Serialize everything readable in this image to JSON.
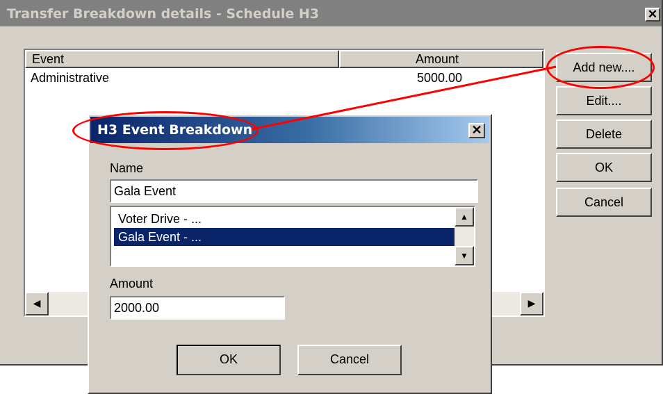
{
  "outer_window": {
    "title": "Transfer Breakdown details - Schedule H3",
    "close_glyph": "✕",
    "list": {
      "columns": [
        "Event",
        "Amount"
      ],
      "rows": [
        {
          "event": "Administrative",
          "amount": "5000.00"
        }
      ]
    },
    "buttons": {
      "add_new": "Add new....",
      "edit": "Edit....",
      "delete": "Delete",
      "ok": "OK",
      "cancel": "Cancel"
    }
  },
  "dialog": {
    "title": "H3 Event Breakdown",
    "close_glyph": "✕",
    "name_label": "Name",
    "name_value": "Gala Event",
    "events": [
      {
        "label": "Voter Drive - ...",
        "selected": false
      },
      {
        "label": "Gala Event - ...",
        "selected": true
      }
    ],
    "amount_label": "Amount",
    "amount_value": "2000.00",
    "ok_label": "OK",
    "cancel_label": "Cancel"
  },
  "annotations": {
    "color": "#ff0000",
    "highlight": [
      "Add new....",
      "H3 Event Breakdown"
    ]
  },
  "colors": {
    "face": "#d4d0c8",
    "selection": "#0a246a",
    "inactive_title": "#808080"
  }
}
